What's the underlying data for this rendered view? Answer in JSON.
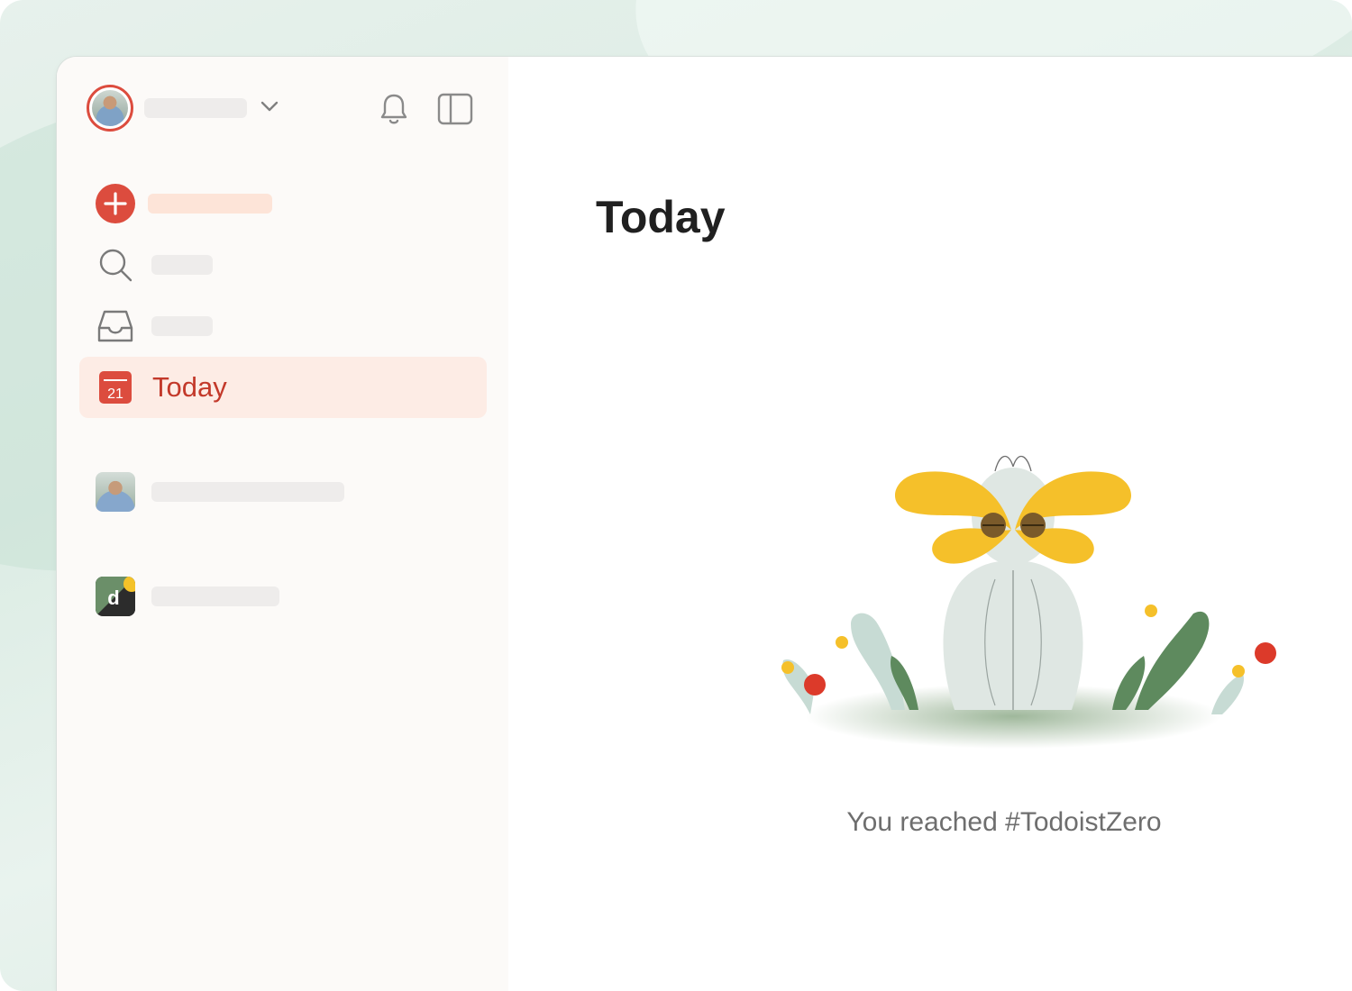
{
  "sidebar": {
    "today_label": "Today",
    "today_date": "21"
  },
  "main": {
    "title": "Today",
    "empty_state_message": "You reached #TodoistZero"
  },
  "colors": {
    "accent": "#dc4c3e",
    "active_bg": "#fdece5",
    "sidebar_bg": "#fcfaf8",
    "butterfly": "#f5c02a",
    "leaf_dark": "#5e8a5e",
    "leaf_light": "#c3d9d2"
  }
}
